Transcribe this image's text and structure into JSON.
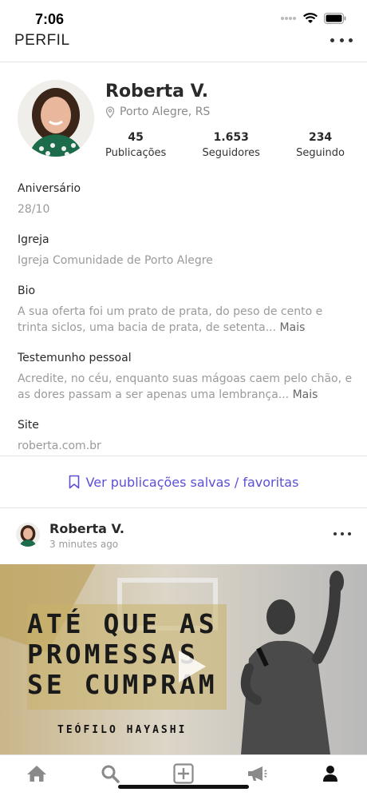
{
  "status_bar": {
    "time": "7:06"
  },
  "header": {
    "title": "PERFIL",
    "more_icon": "ellipsis-icon"
  },
  "profile": {
    "name": "Roberta V.",
    "location": "Porto Alegre, RS",
    "location_icon": "map-pin-icon",
    "stats": [
      {
        "value": "45",
        "label": "Publicações"
      },
      {
        "value": "1.653",
        "label": "Seguidores"
      },
      {
        "value": "234",
        "label": "Seguindo"
      }
    ]
  },
  "info": {
    "birthday": {
      "label": "Aniversário",
      "value": "28/10"
    },
    "church": {
      "label": "Igreja",
      "value": "Igreja Comunidade de Porto Alegre"
    },
    "bio": {
      "label": "Bio",
      "value": "A sua oferta foi um prato de prata, do peso de cento e trinta siclos, uma bacia de prata, de setenta...",
      "more": "Mais"
    },
    "testimony": {
      "label": "Testemunho pessoal",
      "value": "Acredite, no céu, enquanto suas mágoas caem pelo chão, e as dores passam a ser apenas uma lembrança...",
      "more": "Mais"
    },
    "site": {
      "label": "Site",
      "value": "roberta.com.br"
    }
  },
  "saved": {
    "label": "Ver publicações salvas / favoritas",
    "icon": "bookmark-icon",
    "color": "#5b4fd6"
  },
  "post": {
    "author": "Roberta V.",
    "time": "3 minutes ago",
    "media": {
      "title_lines": [
        "ATÉ QUE AS",
        "PROMESSAS",
        "SE CUMPRAM"
      ],
      "subtitle": "TEÓFILO HAYASHI"
    }
  },
  "tab_bar": {
    "tabs": [
      {
        "icon": "home-icon",
        "active": false
      },
      {
        "icon": "search-icon",
        "active": false
      },
      {
        "icon": "add-icon",
        "active": false
      },
      {
        "icon": "megaphone-icon",
        "active": false
      },
      {
        "icon": "profile-icon",
        "active": true
      }
    ]
  }
}
